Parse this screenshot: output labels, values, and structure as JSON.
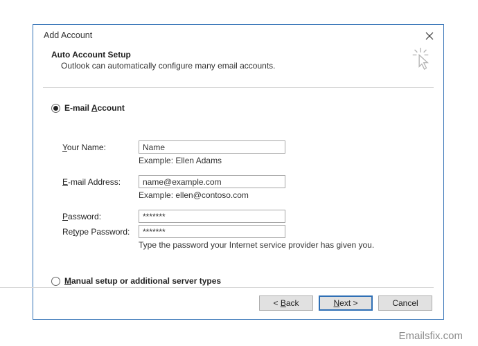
{
  "dialog": {
    "title": "Add Account",
    "header": {
      "title": "Auto Account Setup",
      "subtitle": "Outlook can automatically configure many email accounts."
    },
    "radios": {
      "email_account_html": "<b>E-mail <span class='u'>A</span>ccount</b>",
      "manual_html": "<b><span class='u'>M</span>anual setup or additional server types</b>"
    },
    "form": {
      "your_name_label_html": "<span class='u'>Y</span>our Name:",
      "your_name_value": "Name",
      "your_name_hint": "Example: Ellen Adams",
      "email_label_html": "<span class='u'>E</span>-mail Address:",
      "email_value": "name@example.com",
      "email_hint": "Example: ellen@contoso.com",
      "password_label_html": "<span class='u'>P</span>assword:",
      "password_value": "*******",
      "retype_label_html": "Re<span class='u'>t</span>ype Password:",
      "retype_value": "*******",
      "password_hint": "Type the password your Internet service provider has given you."
    },
    "buttons": {
      "back_html": "&lt; <span class='u'>B</span>ack",
      "next_html": "<span class='u'>N</span>ext &gt;",
      "cancel": "Cancel"
    }
  },
  "watermark": "Emailsfix.com"
}
